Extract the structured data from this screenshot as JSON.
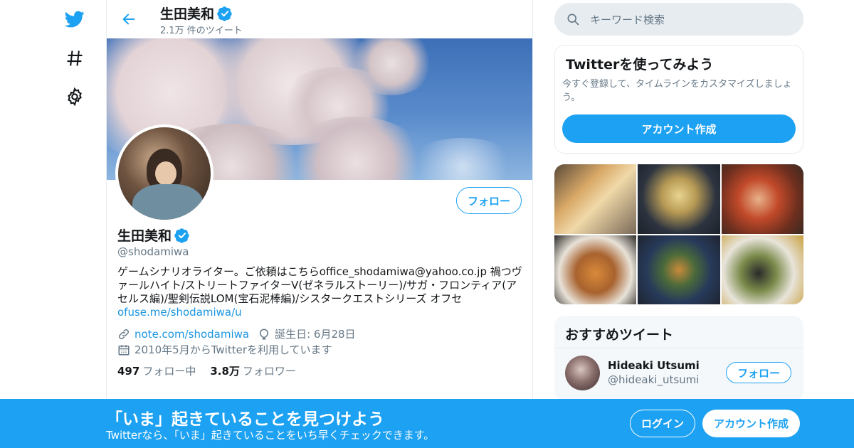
{
  "nav": {
    "items": [
      "twitter-logo",
      "explore-hashtag",
      "settings-gear"
    ]
  },
  "header": {
    "name": "生田美和",
    "tweet_count": "2.1万 件のツイート"
  },
  "profile": {
    "name": "生田美和",
    "handle": "@shodamiwa",
    "follow_label": "フォロー",
    "bio_text": "ゲームシナリオライター。ご依頼はこちらoffice_shodamiwa@yahoo.co.jp 禍つヴァールハイト/ストリートファイターV(ゼネラルストーリー)/サガ・フロンティア(アセルス編)/聖剣伝説LOM(宝石泥棒編)/シスタークエストシリーズ オフセ",
    "bio_link": "ofuse.me/shodamiwa/u",
    "website": "note.com/shodamiwa",
    "birthday": "誕生日: 6月28日",
    "joined": "2010年5月からTwitterを利用しています",
    "following_count": "497",
    "following_label": "フォロー中",
    "followers_count": "3.8万",
    "followers_label": "フォロワー"
  },
  "search": {
    "placeholder": "キーワード検索"
  },
  "signup_card": {
    "title": "Twitterを使ってみよう",
    "text": "今すぐ登録して、タイムラインをカスタマイズしましょう。",
    "button": "アカウント作成"
  },
  "recommend": {
    "title": "おすすめツイート",
    "user_name": "Hideaki Utsumi",
    "user_handle": "@hideaki_utsumi",
    "follow_label": "フォロー"
  },
  "bottom": {
    "title": "「いま」起きていることを見つけよう",
    "subtitle": "Twitterなら、「いま」起きていることをいち早くチェックできます。",
    "login": "ログイン",
    "create": "アカウント作成"
  },
  "colors": {
    "accent": "#1da1f2",
    "text_secondary": "#657786",
    "link": "#1b95e0"
  }
}
